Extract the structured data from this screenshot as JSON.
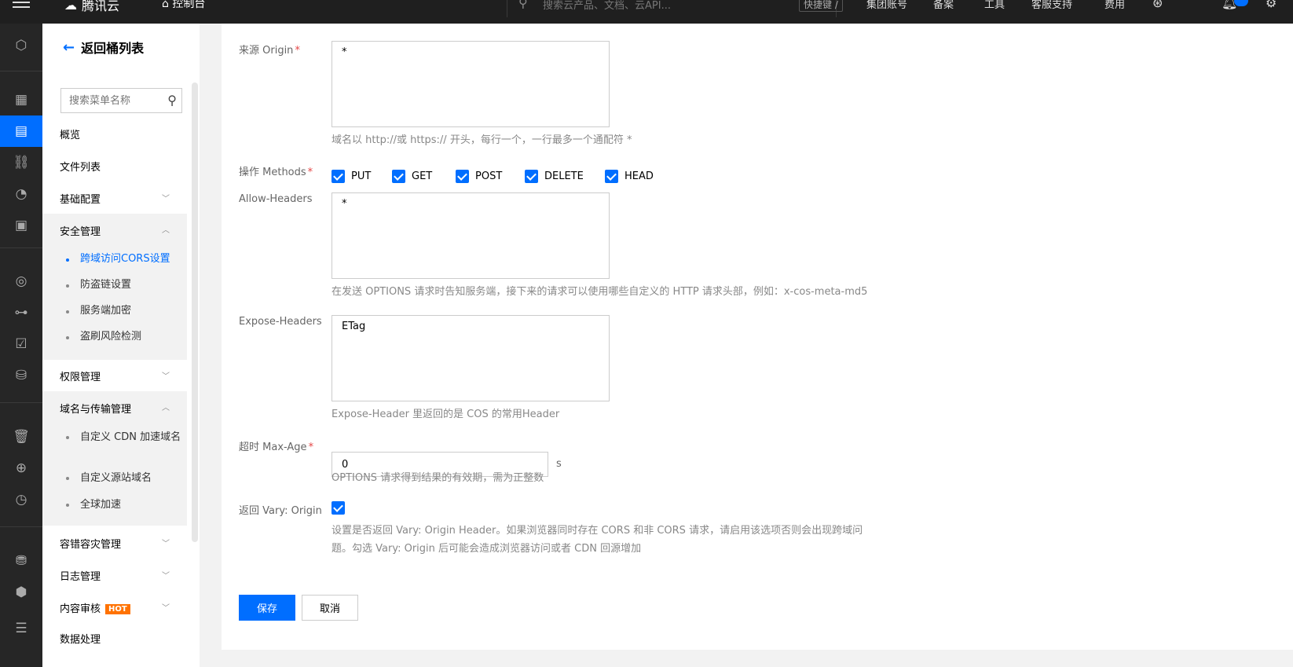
{
  "topbar": {
    "brand": "腾讯云",
    "console": "控制台",
    "search_placeholder": "搜索云产品、文档、云API...",
    "shortcut": "快捷键 /",
    "nav": [
      "集团账号",
      "备案",
      "工具",
      "客服支持",
      "费用"
    ]
  },
  "sidebar": {
    "back_label": "返回桶列表",
    "search_placeholder": "搜索菜单名称",
    "items": {
      "overview": "概览",
      "files": "文件列表",
      "basic": "基础配置",
      "security": "安全管理",
      "cors": "跨域访问CORS设置",
      "hotlink": "防盗链设置",
      "encryption": "服务端加密",
      "risk": "盗刷风险检测",
      "permission": "权限管理",
      "domain": "域名与传输管理",
      "cdn": "自定义 CDN 加速域名",
      "origin": "自定义源站域名",
      "global": "全球加速",
      "dr": "容错容灾管理",
      "log": "日志管理",
      "audit": "内容审核",
      "hot": "HOT",
      "data": "数据处理"
    }
  },
  "form": {
    "origin_label": "来源 Origin",
    "origin_value": "*",
    "origin_hint": "域名以 http://或 https:// 开头，每行一个，一行最多一个通配符 *",
    "methods_label": "操作 Methods",
    "methods": [
      "PUT",
      "GET",
      "POST",
      "DELETE",
      "HEAD"
    ],
    "allow_headers_label": "Allow-Headers",
    "allow_headers_value": "*",
    "allow_headers_hint": "在发送 OPTIONS 请求时告知服务端，接下来的请求可以使用哪些自定义的 HTTP 请求头部，例如：x-cos-meta-md5",
    "expose_headers_label": "Expose-Headers",
    "expose_headers_value": "ETag",
    "expose_headers_hint": "Expose-Header 里返回的是 COS 的常用Header",
    "maxage_label": "超时 Max-Age",
    "maxage_value": "0",
    "maxage_unit": "s",
    "maxage_hint": "OPTIONS 请求得到结果的有效期，需为正整数",
    "vary_label": "返回 Vary: Origin",
    "vary_hint_line1": "设置是否返回 Vary: Origin Header。如果浏览器同时存在 CORS 和非 CORS 请求，请启用该选项否则会出现跨域问",
    "vary_hint_line2": "题。勾选 Vary: Origin 后可能会造成浏览器访问或者 CDN 回源增加",
    "save": "保存",
    "cancel": "取消"
  },
  "colors": {
    "accent": "#006eff",
    "required": "#e54545",
    "hot": "#ff7200"
  }
}
